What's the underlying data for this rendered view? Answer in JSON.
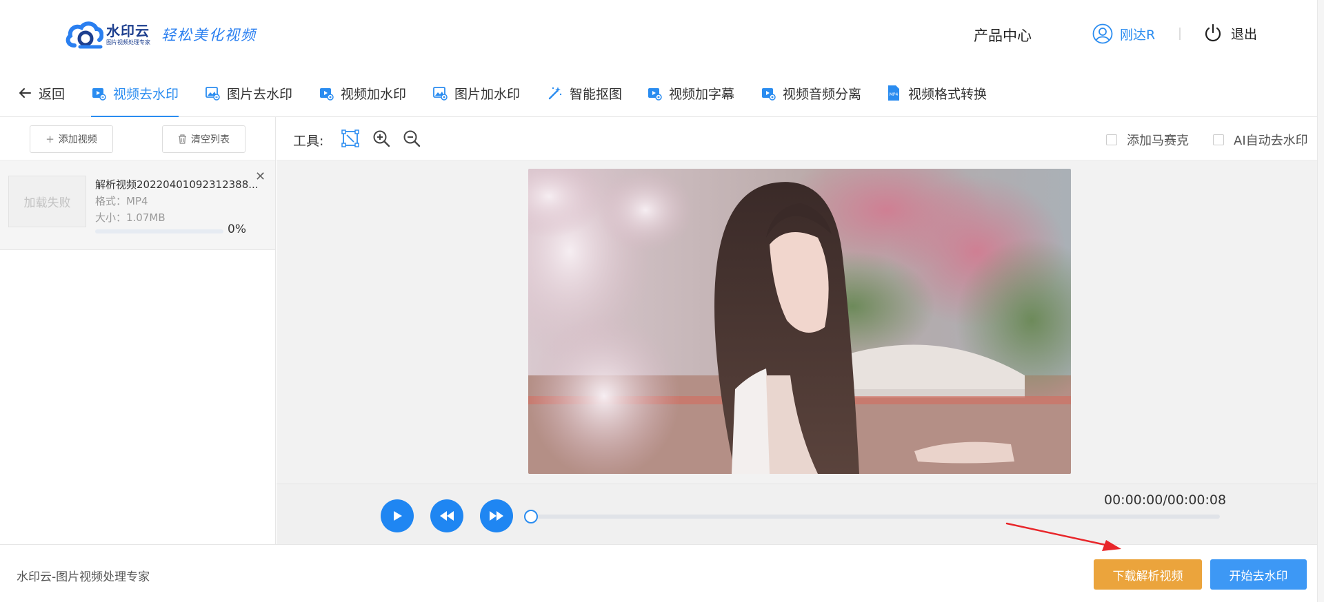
{
  "header": {
    "logo_name": "水印云",
    "logo_sub": "图片视频处理专家",
    "slogan": "轻松美化视频",
    "product_center": "产品中心",
    "username": "刚达R",
    "logout": "退出"
  },
  "tabs": {
    "back": "返回",
    "items": [
      {
        "label": "视频去水印",
        "icon": "video-remove-icon",
        "active": true
      },
      {
        "label": "图片去水印",
        "icon": "image-remove-icon",
        "active": false
      },
      {
        "label": "视频加水印",
        "icon": "video-add-icon",
        "active": false
      },
      {
        "label": "图片加水印",
        "icon": "image-add-icon",
        "active": false
      },
      {
        "label": "智能抠图",
        "icon": "magic-wand-icon",
        "active": false
      },
      {
        "label": "视频加字幕",
        "icon": "video-subtitle-icon",
        "active": false
      },
      {
        "label": "视频音频分离",
        "icon": "video-audio-icon",
        "active": false
      },
      {
        "label": "视频格式转换",
        "icon": "mp4-file-icon",
        "active": false
      }
    ]
  },
  "left_panel": {
    "add_video": "添加视频",
    "clear_list": "清空列表",
    "files": [
      {
        "thumb_text": "加载失败",
        "name": "解析视频20220401092312388...",
        "format": "格式：MP4",
        "size": "大小：1.07MB",
        "progress": 0,
        "progress_text": "0%"
      }
    ]
  },
  "toolbar": {
    "label": "工具:",
    "add_mosaic": "添加马赛克",
    "ai_remove": "AI自动去水印"
  },
  "player": {
    "timecode": "00:00:00/00:00:08",
    "position": 0
  },
  "footer": {
    "brand": "水印云-图片视频处理专家",
    "download": "下载解析视频",
    "start": "开始去水印"
  },
  "colors": {
    "accent": "#2a8cf0",
    "orange": "#eba43c",
    "annotation_arrow": "#e8262a"
  }
}
